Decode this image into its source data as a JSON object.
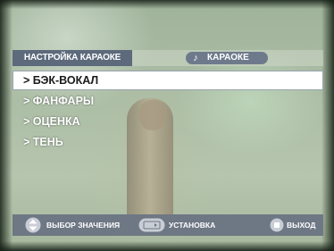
{
  "header": {
    "title": "НАСТРОЙКА КАРАОКЕ",
    "mode_label": "КАРАОКЕ",
    "mode_icon": "music-note-icon"
  },
  "menu": {
    "items": [
      {
        "label": "> БЭК-ВОКАЛ",
        "selected": true
      },
      {
        "label": "> ФАНФАРЫ",
        "selected": false
      },
      {
        "label": "> ОЦЕНКА",
        "selected": false
      },
      {
        "label": "> ТЕНЬ",
        "selected": false
      }
    ]
  },
  "footer": {
    "select_label": "ВЫБОР ЗНАЧЕНИЯ",
    "select_icon": "up-down-arrows-icon",
    "set_label": "УСТАНОВКА",
    "set_icon": "enter-key-icon",
    "exit_label": "ВЫХОД",
    "exit_icon": "stop-button-icon"
  },
  "colors": {
    "header_bg": "#5d6a7c",
    "footer_bg": "#6e7784",
    "selected_bg": "#ffffff"
  }
}
